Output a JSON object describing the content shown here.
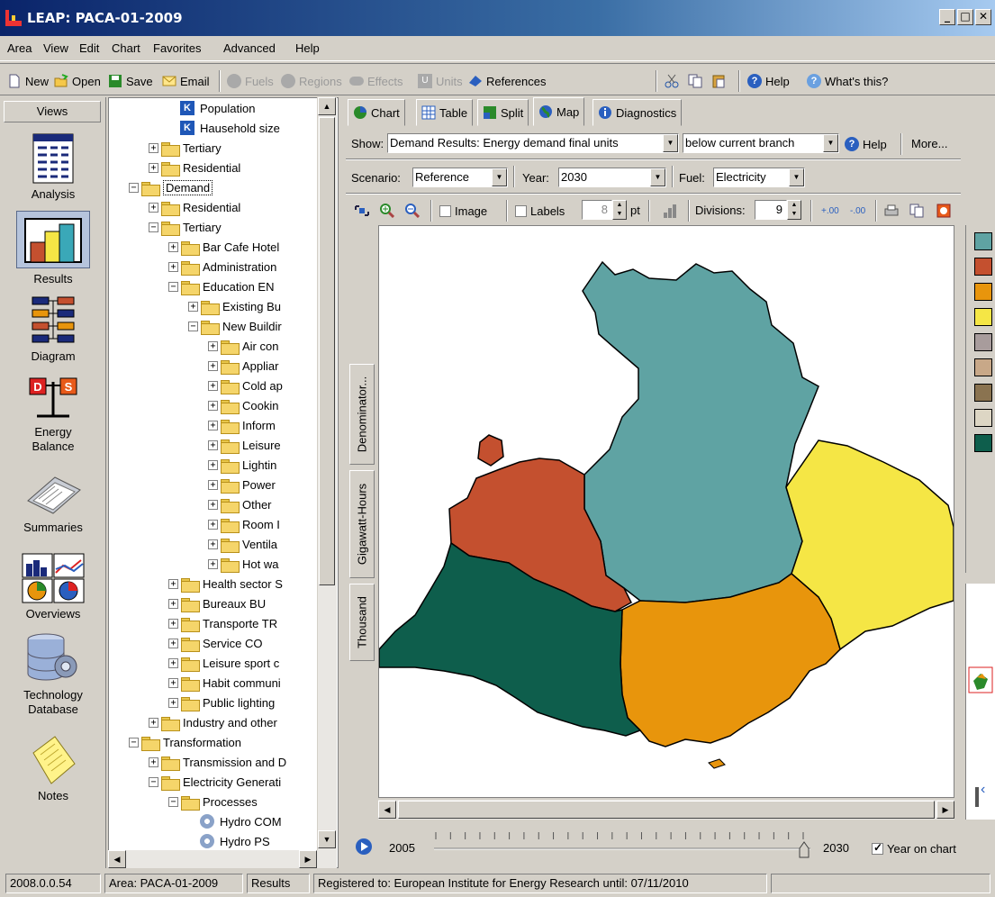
{
  "window": {
    "title": "LEAP: PACA-01-2009"
  },
  "menu": [
    "Area",
    "View",
    "Edit",
    "Chart",
    "Favorites",
    "Advanced",
    "Help"
  ],
  "toolbar": {
    "new": "New",
    "open": "Open",
    "save": "Save",
    "email": "Email",
    "fuels": "Fuels",
    "regions": "Regions",
    "effects": "Effects",
    "units": "Units",
    "references": "References",
    "help": "Help",
    "whats_this": "What's this?"
  },
  "views": {
    "header": "Views",
    "items": [
      "Analysis",
      "Results",
      "Diagram",
      "Energy Balance",
      "Summaries",
      "Overviews",
      "Technology Database",
      "Notes"
    ]
  },
  "tree": [
    {
      "label": "Population",
      "type": "k",
      "indent": 4,
      "exp": ""
    },
    {
      "label": "Hausehold size",
      "type": "k",
      "indent": 4,
      "exp": ""
    },
    {
      "label": "Tertiary",
      "type": "folder",
      "indent": 3,
      "exp": "+"
    },
    {
      "label": "Residential",
      "type": "folder",
      "indent": 3,
      "exp": "+"
    },
    {
      "label": "Demand",
      "type": "folder",
      "indent": 2,
      "exp": "-",
      "selected": true
    },
    {
      "label": "Residential",
      "type": "folder",
      "indent": 3,
      "exp": "+"
    },
    {
      "label": "Tertiary",
      "type": "folder",
      "indent": 3,
      "exp": "-"
    },
    {
      "label": "Bar Cafe Hotel",
      "type": "folder",
      "indent": 4,
      "exp": "+"
    },
    {
      "label": "Administration",
      "type": "folder",
      "indent": 4,
      "exp": "+"
    },
    {
      "label": "Education EN",
      "type": "folder",
      "indent": 4,
      "exp": "-"
    },
    {
      "label": "Existing Bu",
      "type": "folder",
      "indent": 5,
      "exp": "+"
    },
    {
      "label": "New Buildir",
      "type": "folder",
      "indent": 5,
      "exp": "-"
    },
    {
      "label": "Air con",
      "type": "folder",
      "indent": 6,
      "exp": "+"
    },
    {
      "label": "Appliar",
      "type": "folder",
      "indent": 6,
      "exp": "+"
    },
    {
      "label": "Cold ap",
      "type": "folder",
      "indent": 6,
      "exp": "+"
    },
    {
      "label": "Cookin",
      "type": "folder",
      "indent": 6,
      "exp": "+"
    },
    {
      "label": "Inform",
      "type": "folder",
      "indent": 6,
      "exp": "+"
    },
    {
      "label": "Leisure",
      "type": "folder",
      "indent": 6,
      "exp": "+"
    },
    {
      "label": "Lightin",
      "type": "folder",
      "indent": 6,
      "exp": "+"
    },
    {
      "label": "Power",
      "type": "folder",
      "indent": 6,
      "exp": "+"
    },
    {
      "label": "Other",
      "type": "folder",
      "indent": 6,
      "exp": "+"
    },
    {
      "label": "Room I",
      "type": "folder",
      "indent": 6,
      "exp": "+"
    },
    {
      "label": "Ventila",
      "type": "folder",
      "indent": 6,
      "exp": "+"
    },
    {
      "label": "Hot wa",
      "type": "folder",
      "indent": 6,
      "exp": "+"
    },
    {
      "label": "Health sector S",
      "type": "folder",
      "indent": 4,
      "exp": "+"
    },
    {
      "label": "Bureaux BU",
      "type": "folder",
      "indent": 4,
      "exp": "+"
    },
    {
      "label": "Transporte TR",
      "type": "folder",
      "indent": 4,
      "exp": "+"
    },
    {
      "label": "Service CO",
      "type": "folder",
      "indent": 4,
      "exp": "+"
    },
    {
      "label": "Leisure sport c",
      "type": "folder",
      "indent": 4,
      "exp": "+"
    },
    {
      "label": "Habit communi",
      "type": "folder",
      "indent": 4,
      "exp": "+"
    },
    {
      "label": "Public lighting",
      "type": "folder",
      "indent": 4,
      "exp": "+"
    },
    {
      "label": "Industry and other",
      "type": "folder",
      "indent": 3,
      "exp": "+"
    },
    {
      "label": "Transformation",
      "type": "folder",
      "indent": 2,
      "exp": "-"
    },
    {
      "label": "Transmission and D",
      "type": "folder",
      "indent": 3,
      "exp": "+"
    },
    {
      "label": "Electricity Generati",
      "type": "folder",
      "indent": 3,
      "exp": "-"
    },
    {
      "label": "Processes",
      "type": "folder",
      "indent": 4,
      "exp": "-"
    },
    {
      "label": "Hydro COM",
      "type": "gear",
      "indent": 5,
      "exp": ""
    },
    {
      "label": "Hydro PS",
      "type": "gear",
      "indent": 5,
      "exp": ""
    }
  ],
  "tabs": [
    "Chart",
    "Table",
    "Split",
    "Map",
    "Diagnostics"
  ],
  "controls": {
    "show_label": "Show:",
    "show_value": "Demand Results: Energy demand final units",
    "branch_value": "below current branch",
    "help": "Help",
    "more": "More...",
    "scenario_label": "Scenario:",
    "scenario_value": "Reference",
    "year_label": "Year:",
    "year_value": "2030",
    "fuel_label": "Fuel:",
    "fuel_value": "Electricity",
    "image_label": "Image",
    "labels_label": "Labels",
    "labels_size": "8",
    "pt": "pt",
    "divisions_label": "Divisions:",
    "divisions_value": "9"
  },
  "side_tabs": [
    "Denominator...",
    "Gigawatt-Hours",
    "Thousand"
  ],
  "legend_colors": [
    "#5fa3a3",
    "#c4502f",
    "#e8950c",
    "#f5e645",
    "#a89c9c",
    "#c8a888",
    "#8a7350",
    "#ddd6c4",
    "#0e5e4c"
  ],
  "map_colors": {
    "north": "#5fa3a3",
    "west": "#c4502f",
    "east": "#f5e645",
    "south": "#e8950c",
    "southwest": "#0e5e4c"
  },
  "timeline": {
    "start": "2005",
    "end": "2030",
    "year_on_chart": "Year on chart"
  },
  "status": {
    "version": "2008.0.0.54",
    "area": "Area: PACA-01-2009",
    "view": "Results",
    "registered": "Registered to: European Institute for Energy Research until: 07/11/2010"
  }
}
